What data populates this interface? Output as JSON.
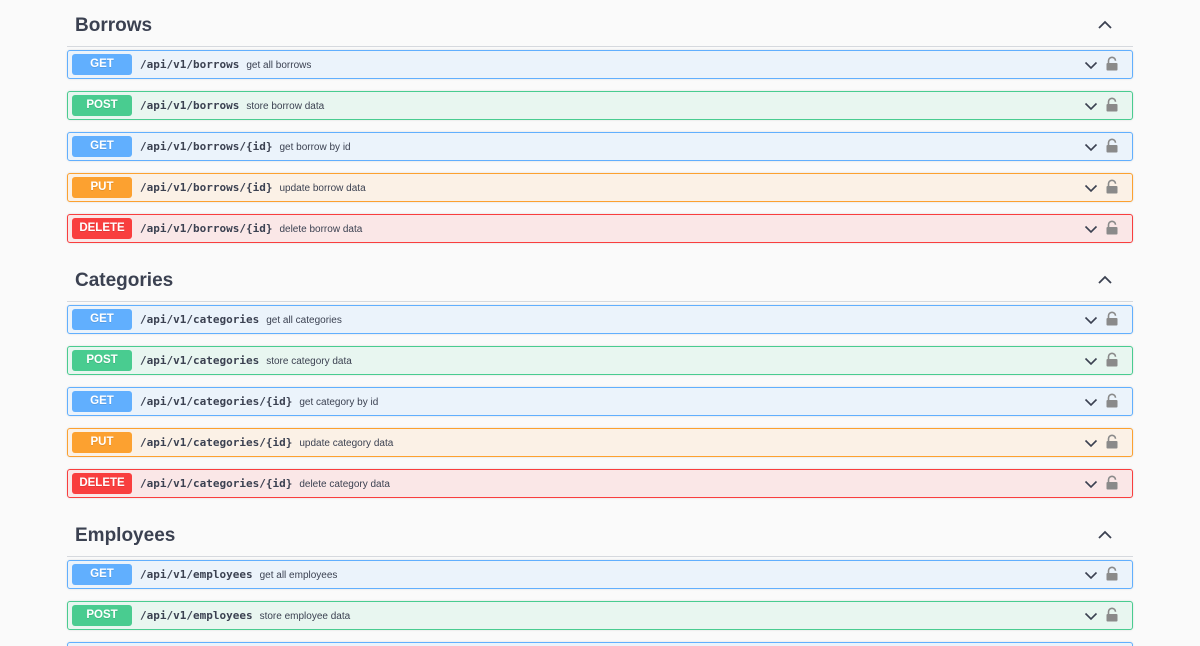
{
  "colors": {
    "get": "#61affe",
    "post": "#49cc90",
    "put": "#fca130",
    "delete": "#f93e3e"
  },
  "sections": [
    {
      "title": "Borrows",
      "toggle_icon": "chevron-up-icon",
      "operations": [
        {
          "method": "GET",
          "path": "/api/v1/borrows",
          "summary": "get all borrows"
        },
        {
          "method": "POST",
          "path": "/api/v1/borrows",
          "summary": "store borrow data"
        },
        {
          "method": "GET",
          "path": "/api/v1/borrows/{id}",
          "summary": "get borrow by id"
        },
        {
          "method": "PUT",
          "path": "/api/v1/borrows/{id}",
          "summary": "update borrow data"
        },
        {
          "method": "DELETE",
          "path": "/api/v1/borrows/{id}",
          "summary": "delete borrow data"
        }
      ]
    },
    {
      "title": "Categories",
      "toggle_icon": "chevron-up-icon",
      "operations": [
        {
          "method": "GET",
          "path": "/api/v1/categories",
          "summary": "get all categories"
        },
        {
          "method": "POST",
          "path": "/api/v1/categories",
          "summary": "store category data"
        },
        {
          "method": "GET",
          "path": "/api/v1/categories/{id}",
          "summary": "get category by id"
        },
        {
          "method": "PUT",
          "path": "/api/v1/categories/{id}",
          "summary": "update category data"
        },
        {
          "method": "DELETE",
          "path": "/api/v1/categories/{id}",
          "summary": "delete category data"
        }
      ]
    },
    {
      "title": "Employees",
      "toggle_icon": "chevron-up-icon",
      "operations": [
        {
          "method": "GET",
          "path": "/api/v1/employees",
          "summary": "get all employees"
        },
        {
          "method": "POST",
          "path": "/api/v1/employees",
          "summary": "store employee data"
        }
      ]
    }
  ]
}
